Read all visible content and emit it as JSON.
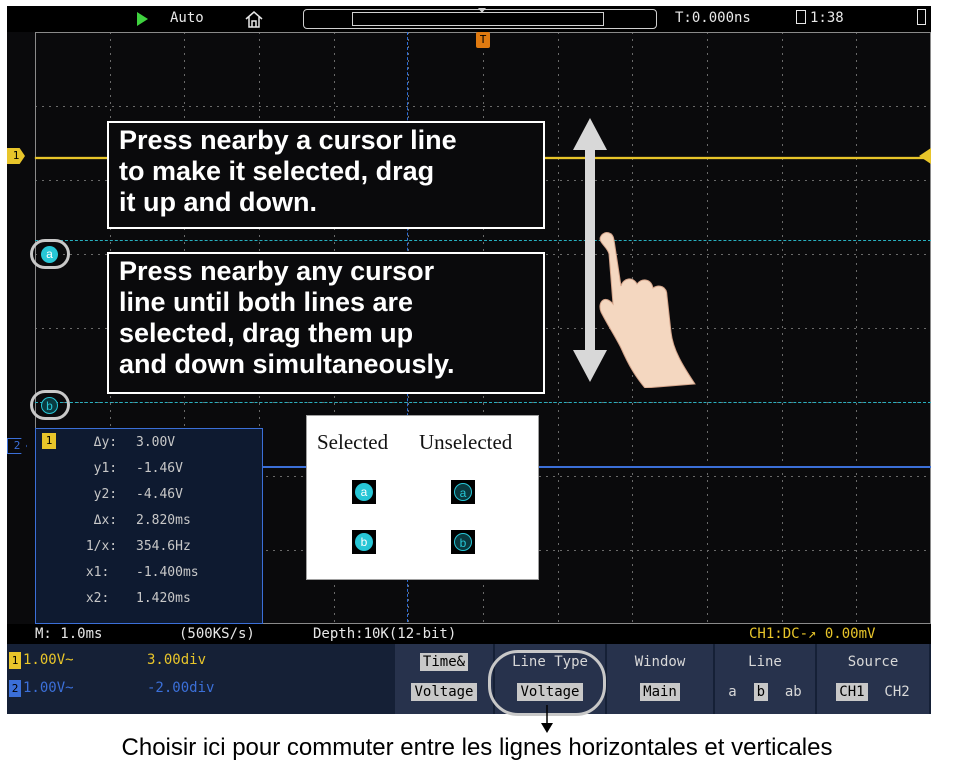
{
  "top_bar": {
    "trigger_mode": "Auto",
    "time_offset": "T:0.000ns",
    "clock": "1:38",
    "icons": [
      "run-indicator-icon",
      "home-icon",
      "lock-icon",
      "battery-icon"
    ]
  },
  "markers": {
    "ch1": "1",
    "ch2": "2",
    "trigger_time": "T",
    "cursor_a": "a",
    "cursor_b": "b"
  },
  "instructions": {
    "single": "Press nearby a cursor line\nto make it selected, drag\nit up and down.",
    "both": "Press nearby any cursor\nline until both lines are\nselected, drag them up\nand down simultaneously."
  },
  "measurements": {
    "channel": "1",
    "rows": [
      {
        "label": "  Δy:",
        "value": "3.00V"
      },
      {
        "label": "  y1:",
        "value": "-1.46V"
      },
      {
        "label": "  y2:",
        "value": "-4.46V"
      },
      {
        "label": "  Δx:",
        "value": "2.820ms"
      },
      {
        "label": " 1/x:",
        "value": "354.6Hz"
      },
      {
        "label": " x1:",
        "value": "-1.400ms"
      },
      {
        "label": " x2:",
        "value": "1.420ms"
      }
    ]
  },
  "legend": {
    "selected_label": "Selected",
    "unselected_label": "Unselected",
    "a": "a",
    "b": "b"
  },
  "status": {
    "timebase": "M: 1.0ms",
    "sample_rate": "(500KS/s)",
    "depth": "Depth:10K(12-bit)",
    "trigger": "CH1:DC-↗ 0.00mV"
  },
  "channels": [
    {
      "num": "1",
      "scale": "1.00V~",
      "cursor_offset": "3.00div",
      "color": "#e8c52a"
    },
    {
      "num": "2",
      "scale": "1.00V~",
      "cursor_offset": "-2.00div",
      "color": "#3b6fd8"
    }
  ],
  "menu": {
    "time_voltage": {
      "title": "Time&",
      "value": "Voltage"
    },
    "line_type": {
      "title": "Line Type",
      "value": "Voltage"
    },
    "window": {
      "title": "Window",
      "value": "Main"
    },
    "line": {
      "title": "Line",
      "options": [
        "a",
        "b",
        "ab"
      ],
      "selected": "b"
    },
    "source": {
      "title": "Source",
      "options": [
        "CH1",
        "CH2"
      ],
      "selected": "CH1"
    }
  },
  "caption": "Choisir ici pour commuter entre les lignes horizontales et verticales",
  "colors": {
    "ch1": "#e8c52a",
    "ch2": "#3b6fd8",
    "cursor": "#27c6d6",
    "trigger": "#e07a10"
  }
}
